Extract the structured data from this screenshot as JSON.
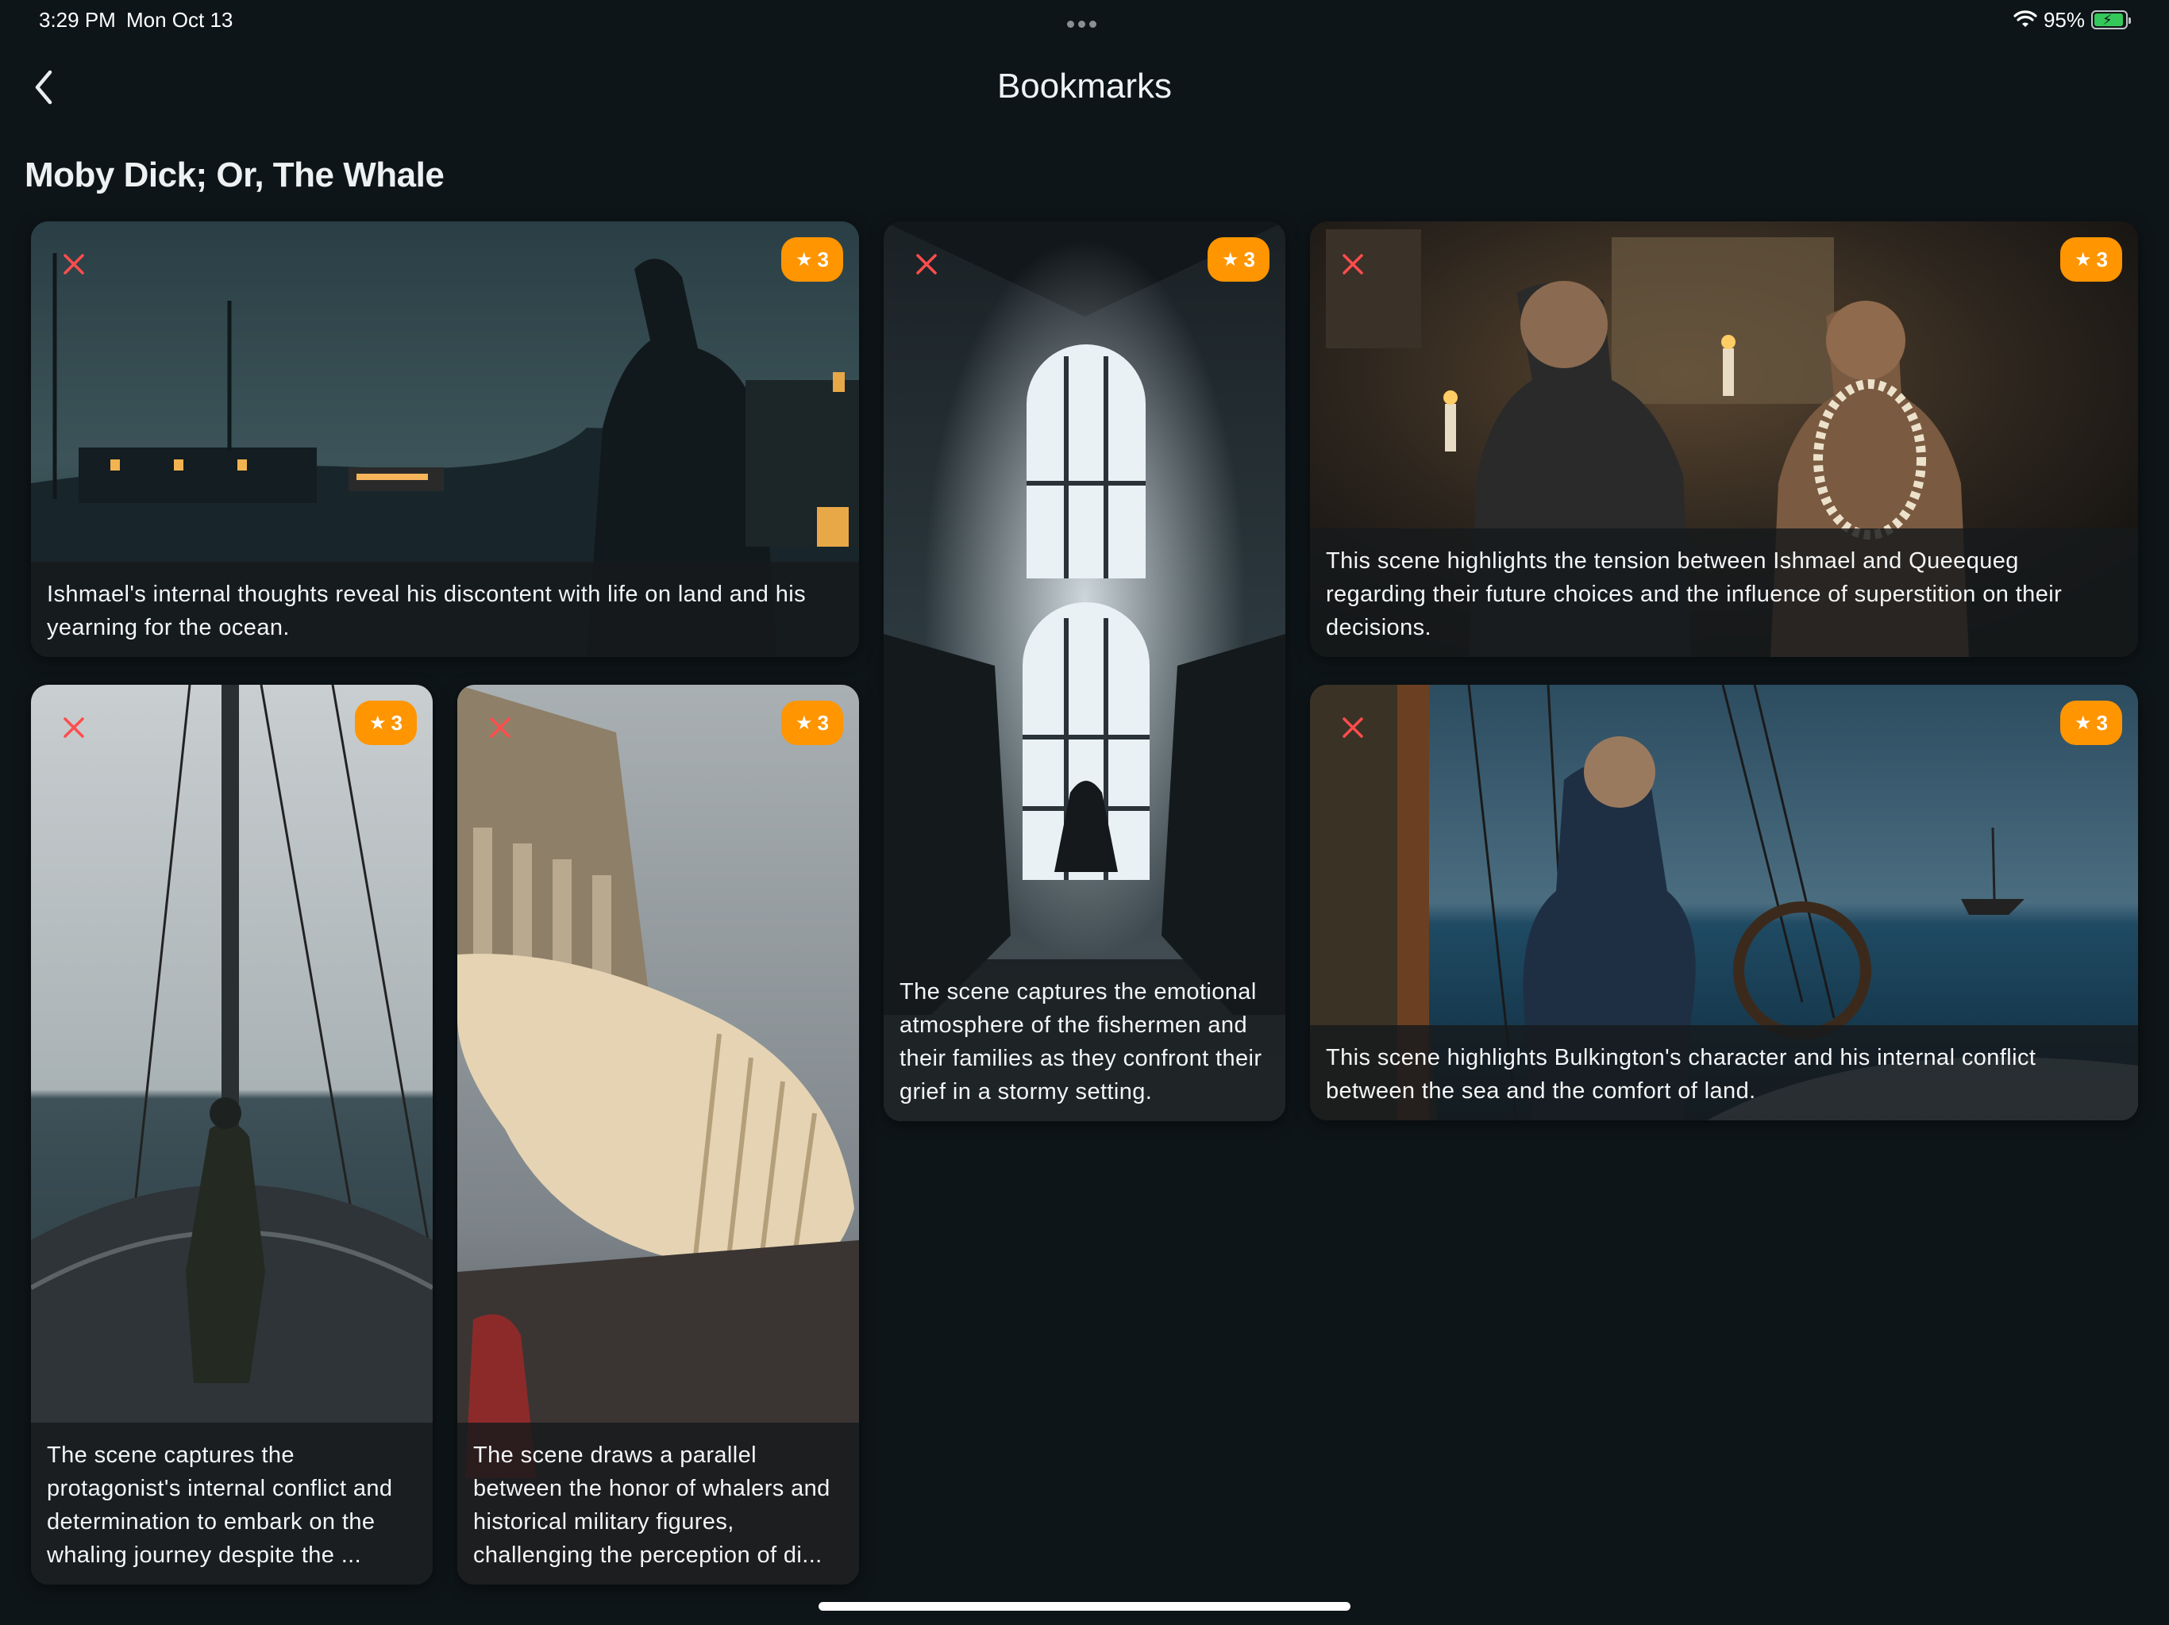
{
  "status_bar": {
    "time": "3:29 PM",
    "date": "Mon Oct 13",
    "battery_percent": "95%",
    "battery_level": 0.95,
    "battery_color": "#34c759"
  },
  "nav": {
    "title": "Bookmarks",
    "back_icon": "chevron-left-icon"
  },
  "section": {
    "book_title": "Moby Dick; Or, The Whale"
  },
  "accent_color": "#ff9500",
  "remove_color": "#ff4d4d",
  "cards": [
    {
      "caption": "Ishmael's internal thoughts reveal his discontent with life on land and his yearning for the ocean.",
      "rating": "3",
      "scene": "harbor-at-dusk"
    },
    {
      "caption": "The scene captures the emotional atmosphere of the fishermen and their families as they confront their grief in a stormy setting.",
      "rating": "3",
      "scene": "chapel-window"
    },
    {
      "caption": "This scene highlights the tension between Ishmael and Queequeg regarding their future choices and the influence of superstition on their decisions.",
      "rating": "3",
      "scene": "candlelit-room"
    },
    {
      "caption": "The scene captures the protagonist's internal conflict and determination to embark on the whaling journey despite the ...",
      "rating": "3",
      "scene": "ship-bow-sea"
    },
    {
      "caption": "The scene draws a parallel between the honor of whalers and historical military figures, challenging the perception of di...",
      "rating": "3",
      "scene": "whale-skeleton"
    },
    {
      "caption": "This scene highlights Bulkington's character and his internal conflict between the sea and the comfort of land.",
      "rating": "3",
      "scene": "stormy-deck"
    }
  ]
}
